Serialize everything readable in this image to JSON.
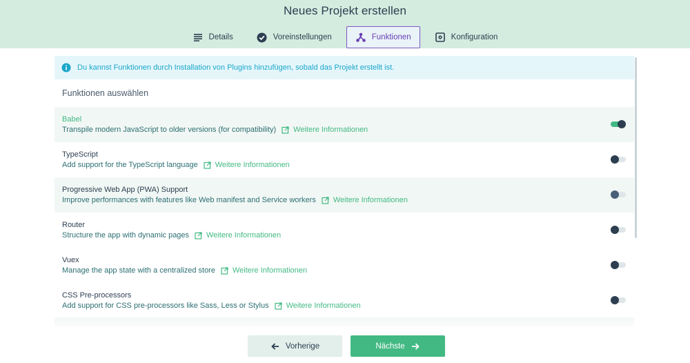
{
  "header": {
    "title": "Neues Projekt erstellen",
    "tabs": [
      {
        "label": "Details",
        "icon": "list-icon"
      },
      {
        "label": "Voreinstellungen",
        "icon": "check-circle-icon"
      },
      {
        "label": "Funktionen",
        "icon": "fork-icon",
        "active": true
      },
      {
        "label": "Konfiguration",
        "icon": "settings-box-icon"
      }
    ]
  },
  "info": {
    "text": "Du kannst Funktionen durch Installation von Plugins hinzufügen, sobald das Projekt erstellt ist."
  },
  "section_title": "Funktionen auswählen",
  "features": [
    {
      "name": "Babel",
      "desc": "Transpile modern JavaScript to older versions (for compatibility)",
      "link": "Weitere Informationen",
      "enabled": true
    },
    {
      "name": "TypeScript",
      "desc": "Add support for the TypeScript language",
      "link": "Weitere Informationen",
      "enabled": false
    },
    {
      "name": "Progressive Web App (PWA) Support",
      "desc": "Improve performances with features like Web manifest and Service workers",
      "link": "Weitere Informationen",
      "enabled": false
    },
    {
      "name": "Router",
      "desc": "Structure the app with dynamic pages",
      "link": "Weitere Informationen",
      "enabled": false
    },
    {
      "name": "Vuex",
      "desc": "Manage the app state with a centralized store",
      "link": "Weitere Informationen",
      "enabled": false
    },
    {
      "name": "CSS Pre-processors",
      "desc": "Add support for CSS pre-processors like Sass, Less or Stylus",
      "link": "Weitere Informationen",
      "enabled": false
    }
  ],
  "footer": {
    "prev_label": "Vorherige",
    "next_label": "Nächste"
  },
  "colors": {
    "accent": "#42b983",
    "header_bg": "#d3ecdf",
    "active_tab": "#7e57c2",
    "info": "#1aa7c9"
  }
}
